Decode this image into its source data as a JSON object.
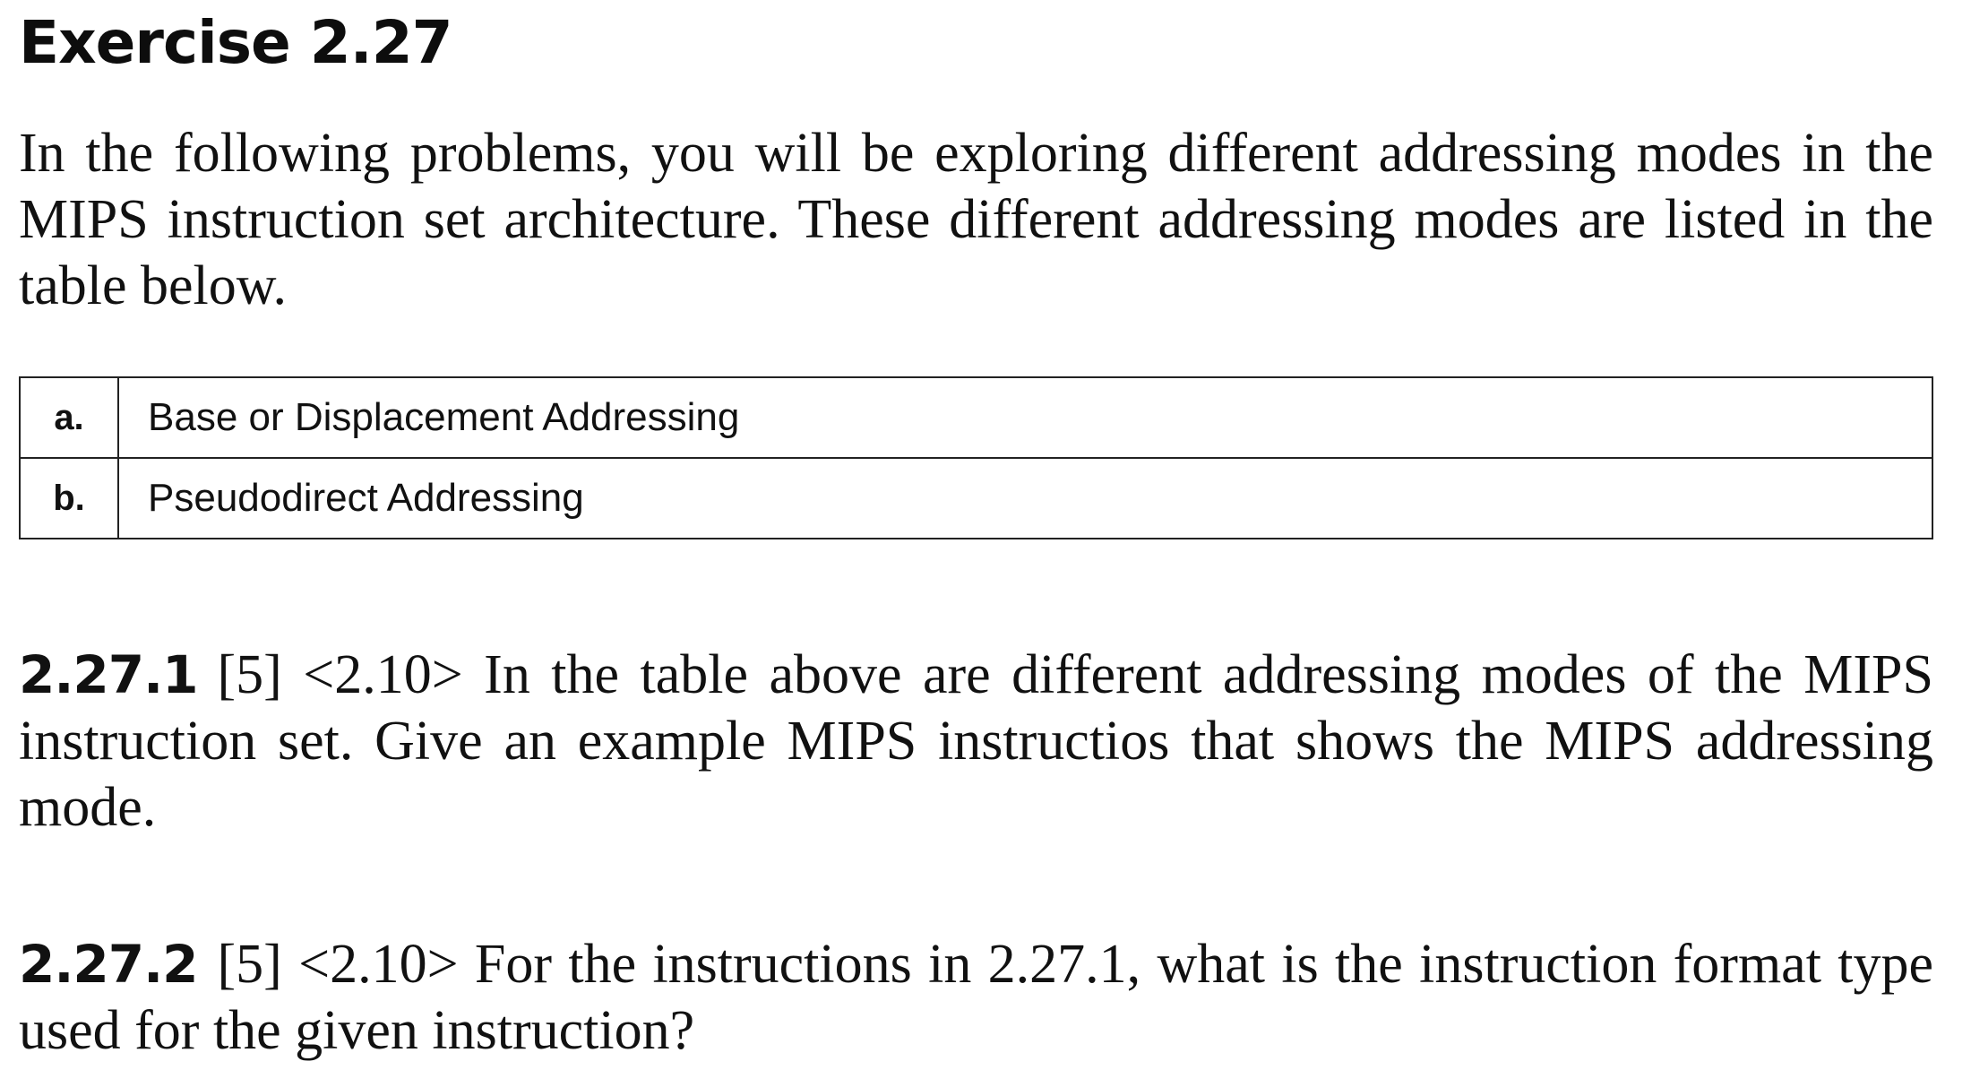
{
  "exercise": {
    "title": "Exercise 2.27",
    "intro": "In the following problems, you will be exploring different addressing modes in the MIPS instruction set architecture. These different addressing modes are listed in the table below."
  },
  "modes_table": {
    "rows": [
      {
        "letter": "a.",
        "mode": "Base or Displacement Addressing"
      },
      {
        "letter": "b.",
        "mode": "Pseudodirect Addressing"
      }
    ]
  },
  "problems": [
    {
      "number": "2.27.1",
      "text": "[5] <2.10> In the table above are different addressing modes of the MIPS instruction set. Give an example MIPS instructios that shows the MIPS addressing mode."
    },
    {
      "number": "2.27.2",
      "text": "[5] <2.10> For the instructions in 2.27.1, what is the instruction format type used for the given instruction?"
    }
  ]
}
